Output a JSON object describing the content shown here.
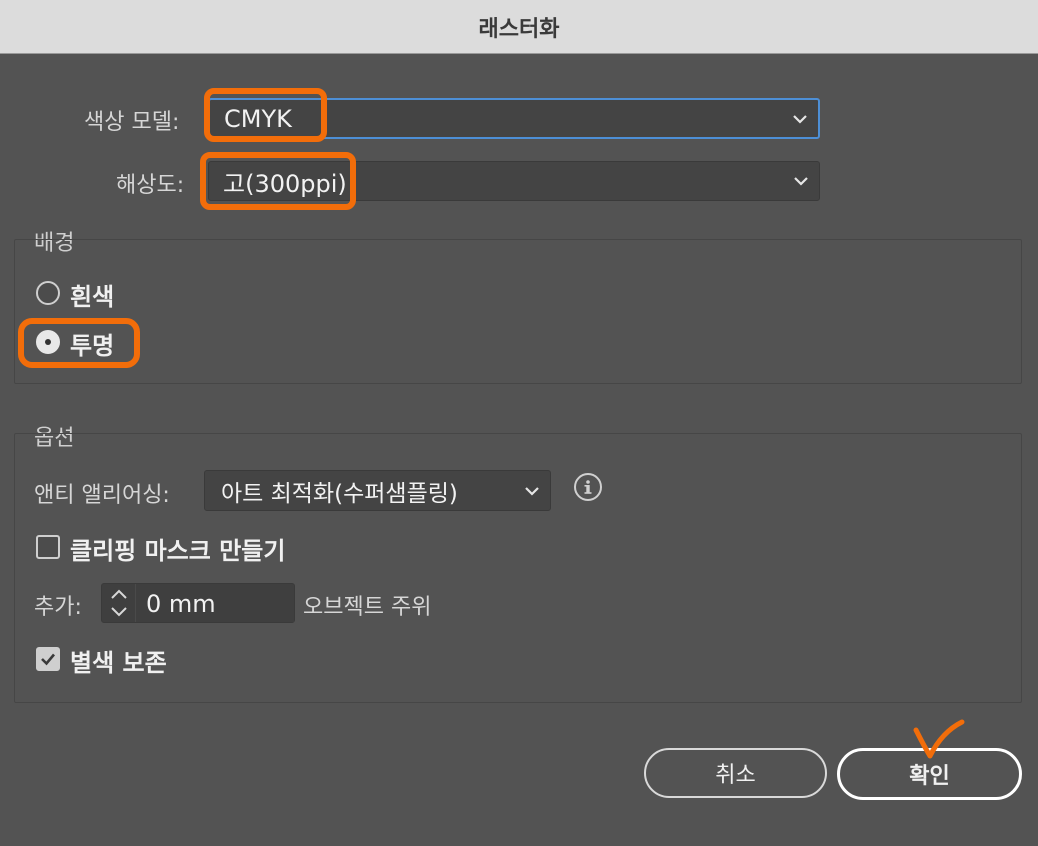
{
  "window": {
    "title": "래스터화"
  },
  "color_model": {
    "label": "색상 모델:",
    "value": "CMYK"
  },
  "resolution": {
    "label": "해상도:",
    "value": "고(300ppi)"
  },
  "background": {
    "title": "배경",
    "options": [
      {
        "label": "흰색",
        "selected": false
      },
      {
        "label": "투명",
        "selected": true
      }
    ]
  },
  "options": {
    "title": "옵션",
    "antialias": {
      "label": "앤티 앨리어싱:",
      "value": "아트 최적화(수퍼샘플링)"
    },
    "clipping_mask": {
      "label": "클리핑 마스크 만들기",
      "checked": false
    },
    "add": {
      "label": "추가:",
      "value": "0 mm",
      "suffix": "오브젝트 주위"
    },
    "preserve_spot": {
      "label": "별색 보존",
      "checked": true
    }
  },
  "buttons": {
    "cancel": "취소",
    "ok": "확인"
  },
  "colors": {
    "annotation": "#f26d0a",
    "focus": "#4d8fd6",
    "background": "#535353"
  },
  "icons": [
    "chevron-down-icon",
    "info-icon",
    "stepper-arrows-icon",
    "checkmark-icon",
    "checkmark-annotation-icon"
  ]
}
